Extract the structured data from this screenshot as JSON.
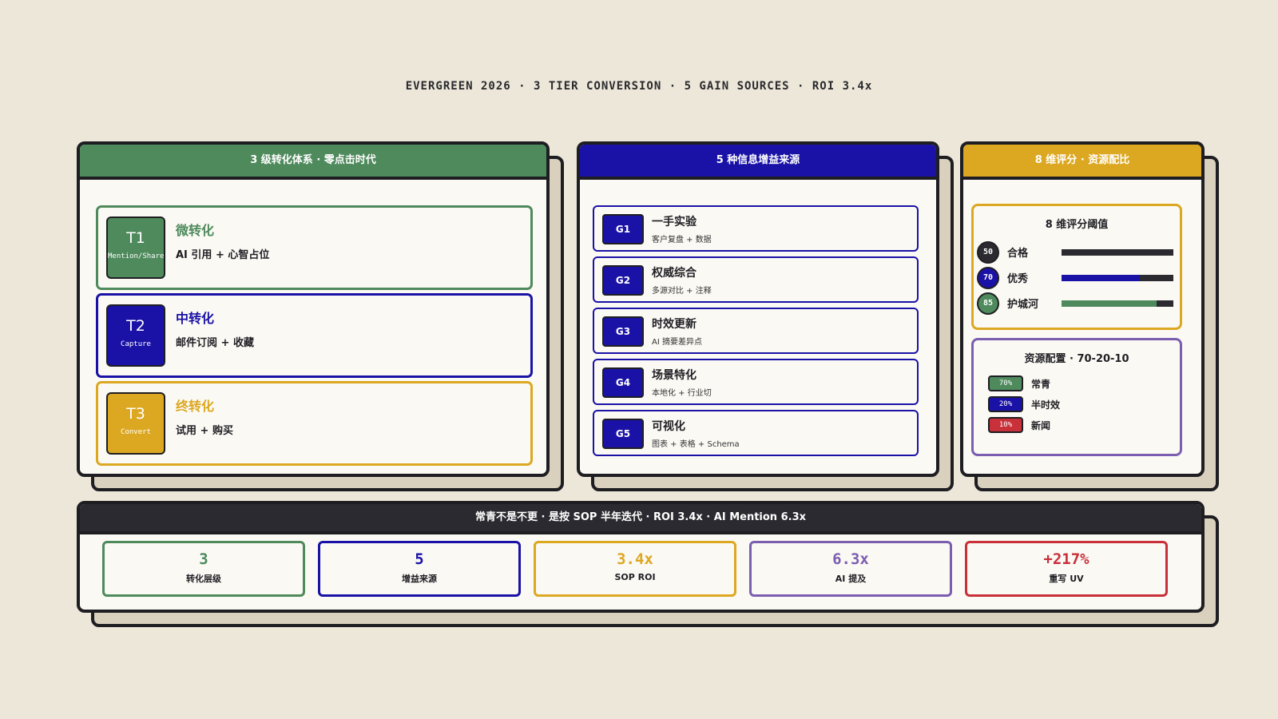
{
  "header": {
    "text": "EVERGREEN 2026 · 3 TIER CONVERSION · 5 GAIN SOURCES · ROI 3.4x"
  },
  "colors": {
    "green": "#4E8A5C",
    "navy": "#1A12A6",
    "gold": "#DCA822",
    "purple": "#7B5EB0",
    "red": "#C8303A",
    "dark": "#2A2A30"
  },
  "tiers_panel": {
    "title": "3 级转化体系 · 零点击时代",
    "tiers": [
      {
        "code": "T1",
        "sub": "Mention/Share",
        "title": "微转化",
        "desc": "AI 引用 + 心智占位"
      },
      {
        "code": "T2",
        "sub": "Capture",
        "title": "中转化",
        "desc": "邮件订阅 + 收藏"
      },
      {
        "code": "T3",
        "sub": "Convert",
        "title": "终转化",
        "desc": "试用 + 购买"
      }
    ]
  },
  "gains_panel": {
    "title": "5 种信息增益来源",
    "items": [
      {
        "code": "G1",
        "title": "一手实验",
        "desc": "客户复盘 + 数据"
      },
      {
        "code": "G2",
        "title": "权威综合",
        "desc": "多源对比 + 注释"
      },
      {
        "code": "G3",
        "title": "时效更新",
        "desc": "AI 摘要差异点"
      },
      {
        "code": "G4",
        "title": "场景特化",
        "desc": "本地化 + 行业切"
      },
      {
        "code": "G5",
        "title": "可视化",
        "desc": "图表 + 表格 + Schema"
      }
    ]
  },
  "score_panel": {
    "title": "8 维评分 · 资源配比",
    "thresholds": {
      "title": "8 维评分阈值",
      "rows": [
        {
          "score": "50",
          "label": "合格",
          "fill": 1.0
        },
        {
          "score": "70",
          "label": "优秀",
          "fill": 0.7
        },
        {
          "score": "85",
          "label": "护城河",
          "fill": 0.85
        }
      ]
    },
    "allocation": {
      "title": "资源配置 · 70-20-10",
      "rows": [
        {
          "pct": "70%",
          "label": "常青"
        },
        {
          "pct": "20%",
          "label": "半时效"
        },
        {
          "pct": "10%",
          "label": "新闻"
        }
      ]
    }
  },
  "bottom_panel": {
    "title": "常青不是不更 · 是按 SOP 半年迭代 · ROI 3.4x · AI Mention 6.3x",
    "stats": [
      {
        "value": "3",
        "label": "转化层级"
      },
      {
        "value": "5",
        "label": "增益来源"
      },
      {
        "value": "3.4x",
        "label": "SOP ROI"
      },
      {
        "value": "6.3x",
        "label": "AI 提及"
      },
      {
        "value": "+217%",
        "label": "重写 UV"
      }
    ]
  }
}
